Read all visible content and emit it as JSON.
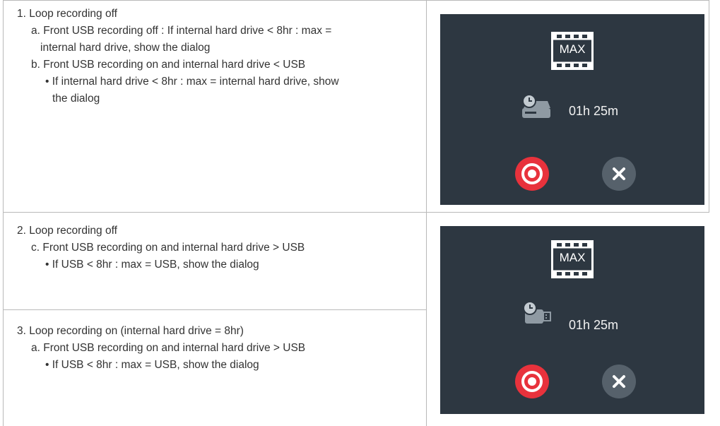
{
  "row1": {
    "lines": [
      "1. Loop recording off",
      "a. Front USB recording off : If internal hard drive < 8hr : max =",
      "internal hard drive, show the dialog",
      "b. Front USB recording on and internal hard drive < USB",
      "• If internal hard drive < 8hr : max = internal hard drive, show",
      "the dialog"
    ]
  },
  "row2": {
    "lines": [
      "2. Loop recording off",
      "c. Front USB recording on and internal hard drive > USB",
      "• If USB < 8hr : max = USB, show the dialog"
    ]
  },
  "row3": {
    "lines": [
      "3. Loop recording on (internal hard drive = 8hr)",
      "a. Front USB recording on and internal hard drive > USB",
      "• If USB < 8hr : max = USB, show the dialog"
    ]
  },
  "dialog1": {
    "badge": "MAX",
    "time": "01h 25m",
    "storage_icon": "internal-hdd-clock-icon",
    "record_icon": "record-icon",
    "close_icon": "close-icon"
  },
  "dialog2": {
    "badge": "MAX",
    "time": "01h 25m",
    "storage_icon": "usb-clock-icon",
    "record_icon": "record-icon",
    "close_icon": "close-icon"
  },
  "colors": {
    "dialog_bg": "#2d3741",
    "record": "#e8323c",
    "close": "#56616b",
    "border": "#b9b9b9"
  }
}
